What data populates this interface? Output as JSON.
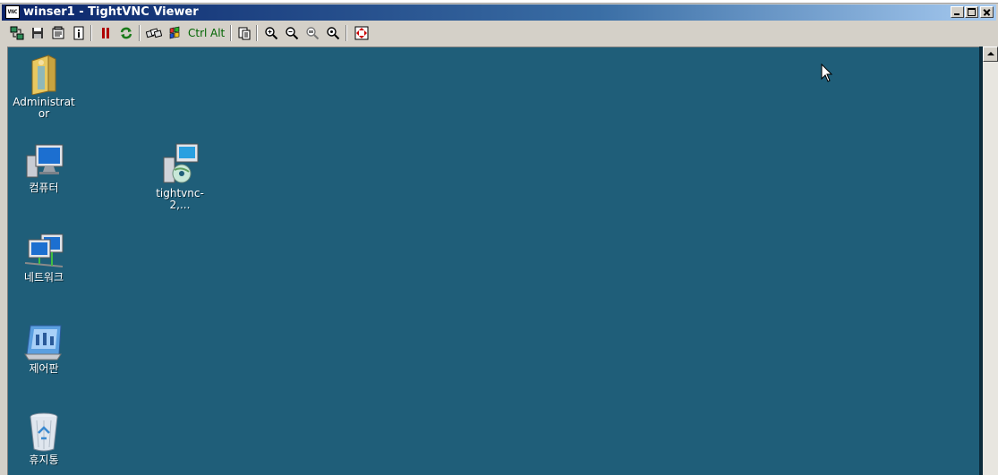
{
  "window": {
    "title": "winser1 - TightVNC Viewer",
    "title_icon_text": "VNC"
  },
  "toolbar": {
    "ctrl_label": "Ctrl",
    "alt_label": "Alt",
    "buttons": [
      "new-connection-icon",
      "save-icon",
      "options-icon",
      "info-icon",
      "pause-icon",
      "refresh-icon",
      "send-ctrl-alt-del-icon",
      "send-ctrl-esc-icon",
      "ctrl-key",
      "alt-key",
      "clipboard-icon",
      "zoom-in-icon",
      "zoom-out-icon",
      "zoom-100-icon",
      "zoom-fit-icon",
      "fullscreen-icon"
    ]
  },
  "desktop": {
    "background": "#1f5e79",
    "icons": [
      {
        "label": "Administrator",
        "icon": "user-folder-icon"
      },
      {
        "label": "컴퓨터",
        "icon": "computer-icon"
      },
      {
        "label": "tightvnc-2,...",
        "icon": "installer-icon"
      },
      {
        "label": "네트워크",
        "icon": "network-icon"
      },
      {
        "label": "제어판",
        "icon": "control-panel-icon"
      },
      {
        "label": "휴지통",
        "icon": "recycle-bin-icon"
      }
    ]
  }
}
